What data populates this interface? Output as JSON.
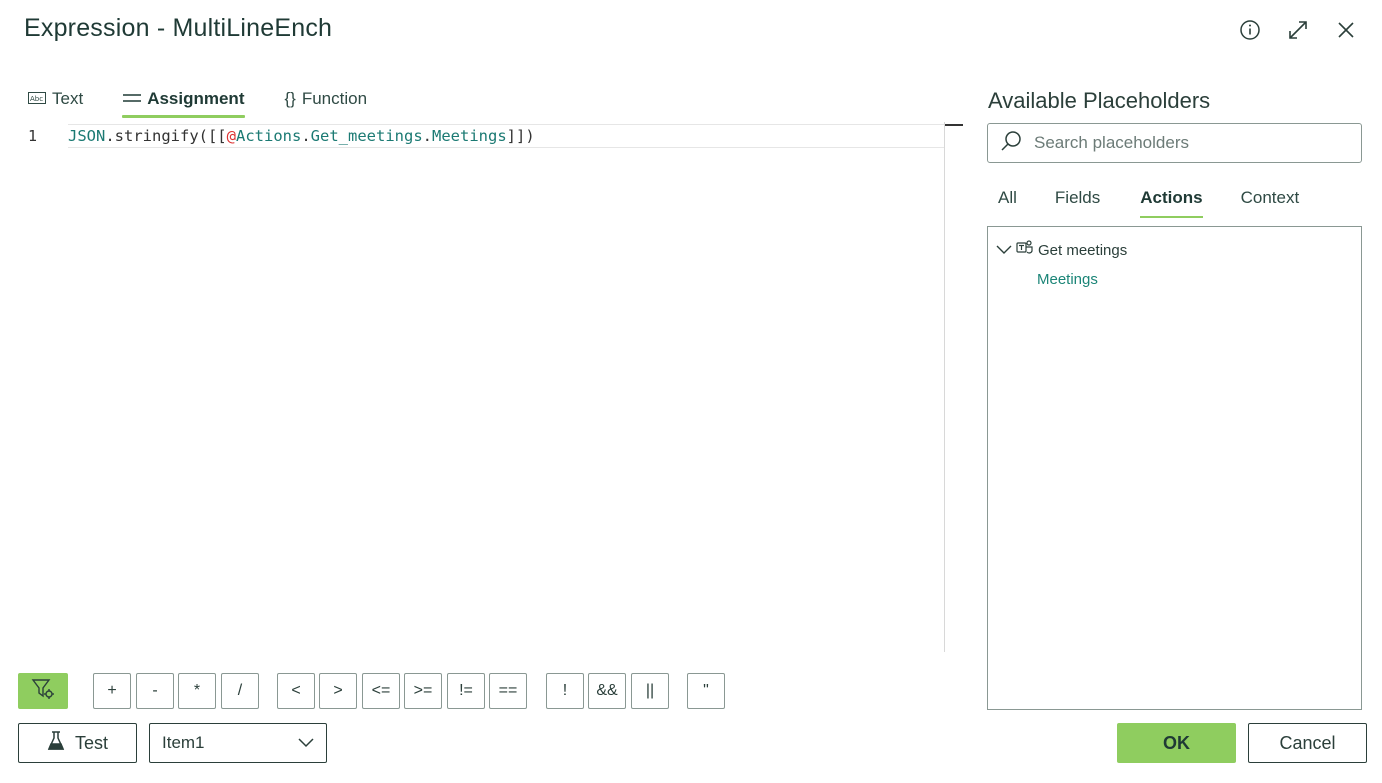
{
  "header": {
    "title": "Expression - MultiLineEnch",
    "icons": [
      "info-icon",
      "expand-icon",
      "close-icon"
    ]
  },
  "mode_tabs": [
    {
      "label": "Text",
      "icon": "text-abc-icon",
      "active": false
    },
    {
      "label": "Assignment",
      "icon": "assignment-icon",
      "active": true
    },
    {
      "label": "Function",
      "icon": "braces-icon",
      "active": false
    }
  ],
  "editor": {
    "line_number": "1",
    "tokens": {
      "json": "JSON",
      "stringify": ".stringify([[",
      "at": "@",
      "actions": "Actions",
      "dot1": ".",
      "get": "Get_meetings",
      "dot2": ".",
      "meetings": "Meetings",
      "close": "]])"
    }
  },
  "operators": [
    "+",
    "-",
    "*",
    "/",
    "<",
    ">",
    "<=",
    ">=",
    "!=",
    "==",
    "!",
    "&&",
    "||",
    "\""
  ],
  "bottom": {
    "test_label": "Test",
    "item_select": "Item1"
  },
  "placeholders": {
    "title": "Available Placeholders",
    "search_placeholder": "Search placeholders",
    "tabs": [
      "All",
      "Fields",
      "Actions",
      "Context"
    ],
    "active_tab": "Actions",
    "tree": {
      "node_label": "Get meetings",
      "node_icon": "teams-icon",
      "leaf_label": "Meetings"
    }
  },
  "actions": {
    "ok_label": "OK",
    "cancel_label": "Cancel"
  },
  "colors": {
    "accent": "#8fcd5f",
    "text_dark": "#1f3a35",
    "link": "#1b8577"
  }
}
